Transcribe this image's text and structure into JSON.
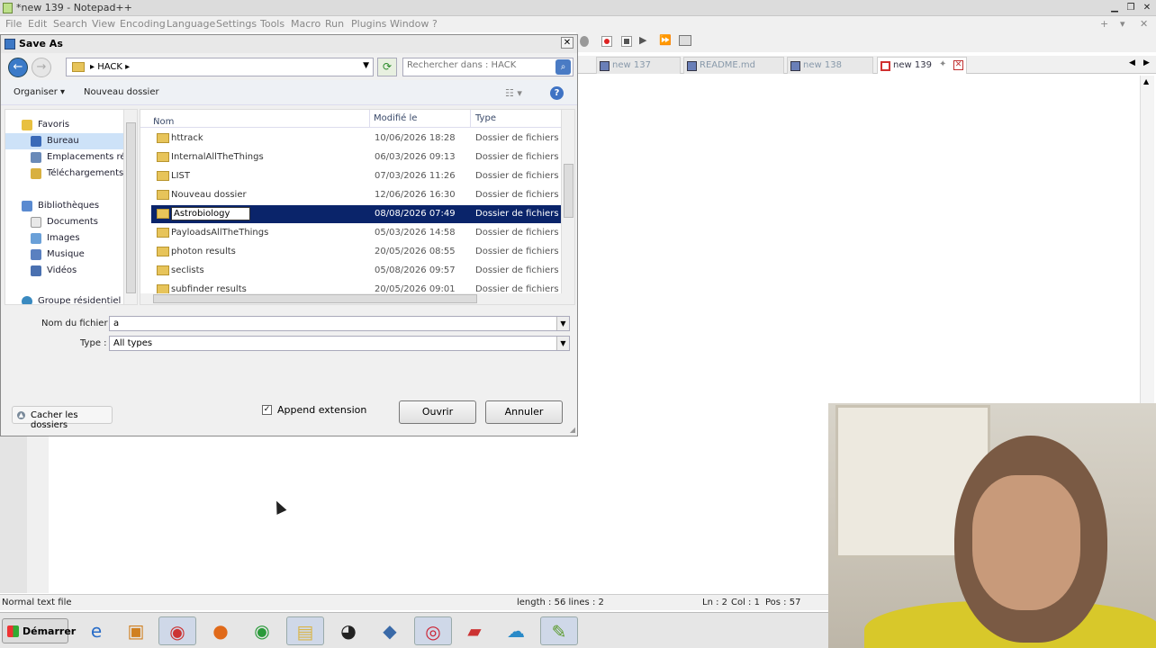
{
  "npp": {
    "title": "*new 139 - Notepad++",
    "menu": [
      "File",
      "Edit",
      "Search",
      "View",
      "Encoding",
      "Language",
      "Settings",
      "Tools",
      "Macro",
      "Run",
      "Plugins",
      "Window",
      "?"
    ],
    "tabs": [
      {
        "label": "new 137",
        "active": false
      },
      {
        "label": "README.md",
        "active": false
      },
      {
        "label": "new 138",
        "active": false
      },
      {
        "label": "new 139",
        "active": true
      }
    ],
    "status": {
      "type": "Normal text file",
      "length": "length : 56   lines : 2",
      "ln": "Ln : 2",
      "col": "Col : 1",
      "pos": "Pos : 57"
    }
  },
  "dialog": {
    "title": "Save As",
    "breadcrumb": "HACK",
    "search_placeholder": "Rechercher dans : HACK",
    "organize": "Organiser",
    "new_folder": "Nouveau dossier",
    "nav": {
      "favorites": "Favoris",
      "desktop": "Bureau",
      "recent": "Emplacements réce",
      "downloads": "Téléchargements",
      "libraries": "Bibliothèques",
      "documents": "Documents",
      "images": "Images",
      "music": "Musique",
      "videos": "Vidéos",
      "homegroup": "Groupe résidentiel"
    },
    "columns": {
      "name": "Nom",
      "modified": "Modifié le",
      "type": "Type"
    },
    "files": [
      {
        "name": "httrack",
        "modified": "10/06/2026 18:28",
        "type": "Dossier de fichiers",
        "selected": false
      },
      {
        "name": "InternalAllTheThings",
        "modified": "06/03/2026 09:13",
        "type": "Dossier de fichiers",
        "selected": false
      },
      {
        "name": "LIST",
        "modified": "07/03/2026 11:26",
        "type": "Dossier de fichiers",
        "selected": false
      },
      {
        "name": "Nouveau dossier",
        "modified": "12/06/2026 16:30",
        "type": "Dossier de fichiers",
        "selected": false
      },
      {
        "name": "Astrobiology",
        "modified": "08/08/2026 07:49",
        "type": "Dossier de fichiers",
        "selected": true
      },
      {
        "name": "PayloadsAllTheThings",
        "modified": "05/03/2026 14:58",
        "type": "Dossier de fichiers",
        "selected": false
      },
      {
        "name": "photon results",
        "modified": "20/05/2026 08:55",
        "type": "Dossier de fichiers",
        "selected": false
      },
      {
        "name": "seclists",
        "modified": "05/08/2026 09:57",
        "type": "Dossier de fichiers",
        "selected": false
      },
      {
        "name": "subfinder results",
        "modified": "20/05/2026 09:01",
        "type": "Dossier de fichiers",
        "selected": false
      }
    ],
    "filename_label": "Nom du fichier :",
    "filename_value": "a",
    "type_label": "Type :",
    "type_value": "All types",
    "hide_folders": "Cacher les dossiers",
    "append_extension": "Append extension",
    "append_checked": true,
    "open_button": "Ouvrir",
    "cancel_button": "Annuler"
  },
  "taskbar": {
    "start": "Démarrer",
    "apps": [
      "ie-icon",
      "media-icon",
      "chrome-icon",
      "firefox-icon",
      "chrome-alt-icon",
      "explorer-icon",
      "obs-icon",
      "vm-icon",
      "audio-icon",
      "notepad-alt-icon",
      "cloud-icon",
      "notepadpp-icon"
    ]
  }
}
